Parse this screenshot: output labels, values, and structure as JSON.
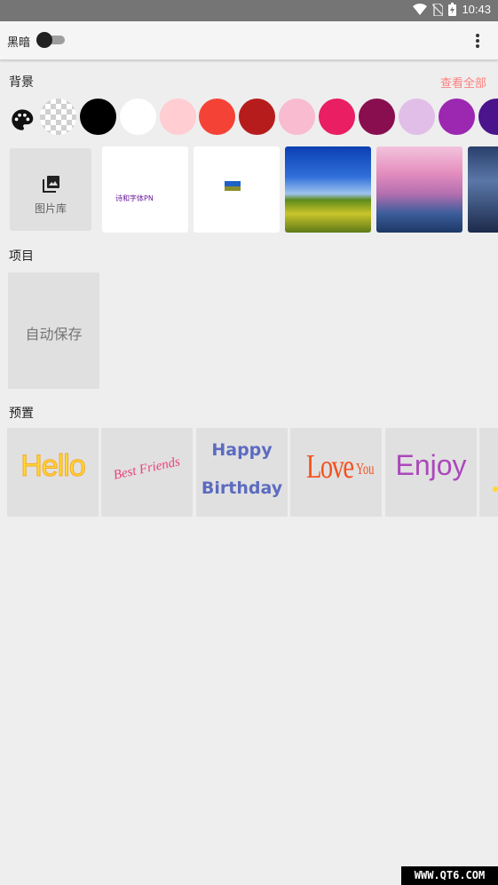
{
  "status_bar": {
    "time": "10:43",
    "icons": [
      "wifi-icon",
      "no-sim-icon",
      "battery-charging-icon"
    ]
  },
  "toolbar": {
    "dark_mode_label": "黑暗",
    "dark_mode_on": false,
    "menu_icon": "more-vert-icon"
  },
  "background": {
    "title": "背景",
    "see_all": "查看全部",
    "colors": [
      "palette",
      "transparent",
      "#000000",
      "#ffffff",
      "#ffcdd2",
      "#f44336",
      "#b71c1c",
      "#f8bbd0",
      "#e91e63",
      "#880e4f",
      "#e1bee7",
      "#9c27b0",
      "#4a148c"
    ],
    "gallery_label": "图片库",
    "thumbnails": [
      "white-text-image",
      "white-small-image",
      "rapeseed-flowers-sky-photo",
      "cherry-blossom-night-photo",
      "anime-night-scene-photo"
    ],
    "thumb_text": "诗和字体PN"
  },
  "projects": {
    "title": "项目",
    "autosave": "自动保存"
  },
  "presets": {
    "title": "预置",
    "items": [
      {
        "text": "Hello",
        "color": "#fdd835"
      },
      {
        "text": "Best Friends",
        "color": "#ec407a"
      },
      {
        "line1": "Happy",
        "line2": "Birthday",
        "color": "#5c6bc0"
      },
      {
        "text": "Love",
        "small": "You",
        "color": "#f4511e"
      },
      {
        "text": "Enjoy",
        "color": "#ab47bc"
      }
    ]
  },
  "watermark": "WWW.QT6.COM"
}
